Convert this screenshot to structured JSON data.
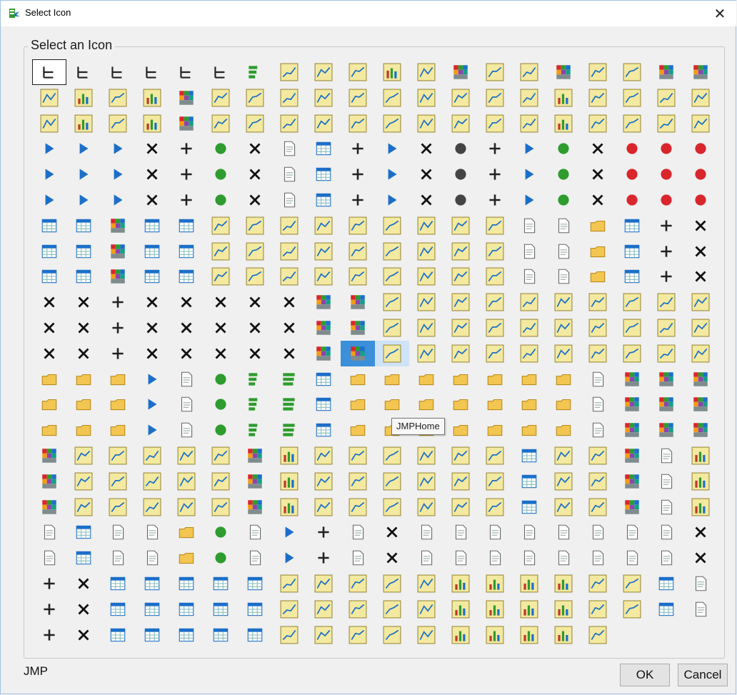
{
  "window": {
    "title": "Select Icon",
    "close_glyph": "✕"
  },
  "group": {
    "label": "Select an Icon"
  },
  "tooltip": {
    "text": "JMPHome"
  },
  "footer": {
    "status": "JMP",
    "ok_label": "OK",
    "cancel_label": "Cancel"
  },
  "grid": {
    "columns": 20,
    "rows": 23,
    "last_row_count": 17
  },
  "state": {
    "selected_index": 0,
    "highlighted_index": 229,
    "hovered_index": 230,
    "hovered_name": "JMPHome"
  },
  "colors": {
    "accent_blue": "#1c6fc9",
    "tile_yellow": "#f3e9a0",
    "tile_border": "#9a8a3a",
    "highlight": "#3c8fd9",
    "green": "#2e9c2e",
    "red": "#d9262c"
  }
}
